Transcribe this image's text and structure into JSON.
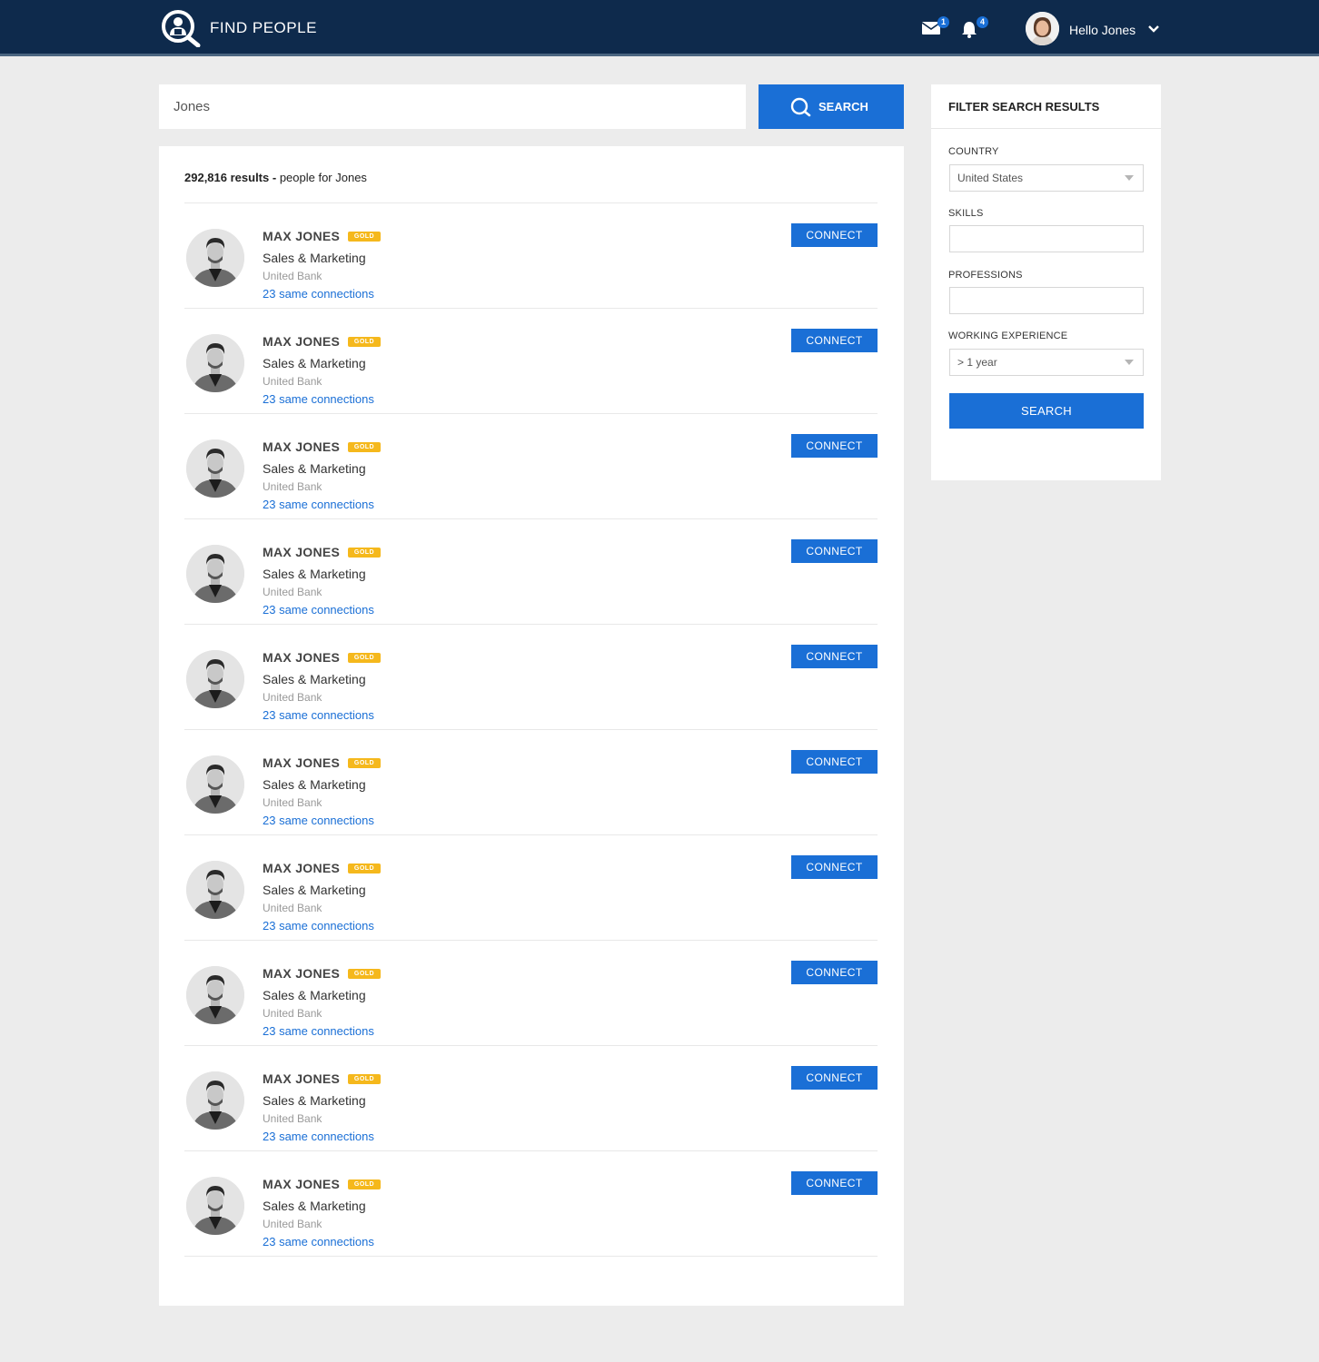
{
  "header": {
    "app_title": "FIND PEOPLE",
    "mail_badge": "1",
    "notification_badge": "4",
    "greeting": "Hello Jones",
    "icons": [
      "app-logo-icon",
      "mail-icon",
      "bell-icon",
      "chevron-down-icon"
    ]
  },
  "search": {
    "query": "Jones",
    "button_label": "SEARCH"
  },
  "results": {
    "count": "292,816 results -",
    "query_text": "people for Jones",
    "items": [
      {
        "name": "MAX JONES",
        "badge": "GOLD",
        "title": "Sales & Marketing",
        "company": "United Bank",
        "connections": "23 same connections",
        "button": "CONNECT"
      },
      {
        "name": "MAX JONES",
        "badge": "GOLD",
        "title": "Sales & Marketing",
        "company": "United Bank",
        "connections": "23 same connections",
        "button": "CONNECT"
      },
      {
        "name": "MAX JONES",
        "badge": "GOLD",
        "title": "Sales & Marketing",
        "company": "United Bank",
        "connections": "23 same connections",
        "button": "CONNECT"
      },
      {
        "name": "MAX JONES",
        "badge": "GOLD",
        "title": "Sales & Marketing",
        "company": "United Bank",
        "connections": "23 same connections",
        "button": "CONNECT"
      },
      {
        "name": "MAX JONES",
        "badge": "GOLD",
        "title": "Sales & Marketing",
        "company": "United Bank",
        "connections": "23 same connections",
        "button": "CONNECT"
      },
      {
        "name": "MAX JONES",
        "badge": "GOLD",
        "title": "Sales & Marketing",
        "company": "United Bank",
        "connections": "23 same connections",
        "button": "CONNECT"
      },
      {
        "name": "MAX JONES",
        "badge": "GOLD",
        "title": "Sales & Marketing",
        "company": "United Bank",
        "connections": "23 same connections",
        "button": "CONNECT"
      },
      {
        "name": "MAX JONES",
        "badge": "GOLD",
        "title": "Sales & Marketing",
        "company": "United Bank",
        "connections": "23 same connections",
        "button": "CONNECT"
      },
      {
        "name": "MAX JONES",
        "badge": "GOLD",
        "title": "Sales & Marketing",
        "company": "United Bank",
        "connections": "23 same connections",
        "button": "CONNECT"
      },
      {
        "name": "MAX JONES",
        "badge": "GOLD",
        "title": "Sales & Marketing",
        "company": "United Bank",
        "connections": "23 same connections",
        "button": "CONNECT"
      }
    ]
  },
  "filter": {
    "title": "FILTER SEARCH RESULTS",
    "country_label": "COUNTRY",
    "country_value": "United States",
    "skills_label": "SKILLS",
    "skills_value": "",
    "professions_label": "PROFESSIONS",
    "professions_value": "",
    "experience_label": "WORKING EXPERIENCE",
    "experience_value": "> 1 year",
    "button_label": "SEARCH"
  },
  "colors": {
    "header_bg": "#0e2a4c",
    "accent": "#1a6fd6",
    "gold": "#f5b81c",
    "page_bg": "#ececec"
  }
}
